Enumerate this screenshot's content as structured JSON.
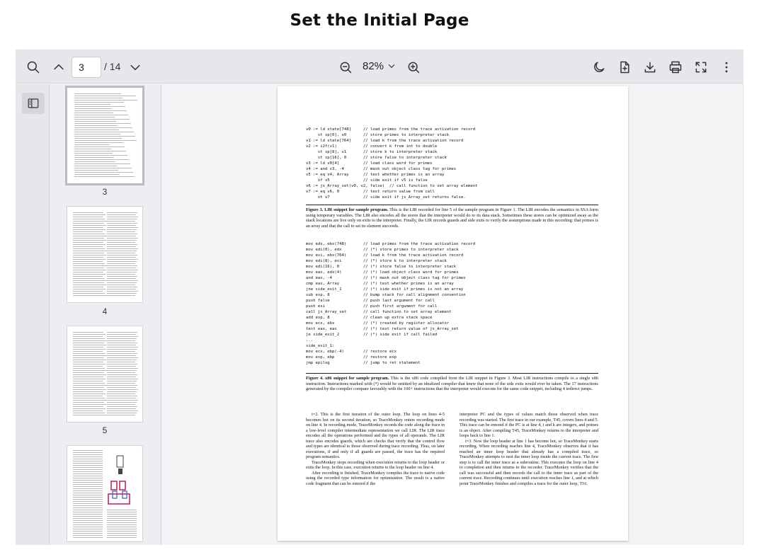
{
  "page_title": "Set the Initial Page",
  "toolbar": {
    "current_page": "3",
    "total_pages": "/ 14",
    "zoom": "82%"
  },
  "thumbnails": [
    {
      "label": "3",
      "active": true
    },
    {
      "label": "4",
      "active": false
    },
    {
      "label": "5",
      "active": false
    },
    {
      "label": "",
      "active": false
    }
  ],
  "document": {
    "code1": "v0 := ld state[748]     // load primes from the trace activation record\n     st sp[0], v0       // store primes to interpreter stack\nv1 := ld state[764]     // load k from the trace activation record\nv2 := i2f(v1)           // convert k from int to double\n     st sp[8], v1       // store k to interpreter stack\n     st sp[16], 0       // store false to interpreter stack\nv3 := ld v0[4]          // load class word for primes\nv4 := and v3, -4        // mask out object class tag for primes\nv5 := eq v4, Array      // test whether primes is an array\n     xf v5              // side exit if v5 is false\nv6 := js_Array_set(v0, v2, false)  // call function to set array element\nv7 := eq v6, 0          // test return value from call\n     xt v7              // side exit if js_Array_set returns false.",
    "caption1_bold": "Figure 3.  LIR snippet for sample program.",
    "caption1_text": " This is the LIR recorded for line 5 of the sample program in Figure 1. The LIR encodes the semantics in SSA form using temporary variables. The LIR also encodes all the stores that the interpreter would do to its data stack. Sometimes these stores can be optimized away as the stack locations are live only on exits to the interpreter. Finally, the LIR records guards and side exits to verify the assumptions made in this recording: that primes is an array and that the call to set its element succeeds.",
    "code2": "mov edx, ebx(748)       // load primes from the trace activation record\nmov edi(0), edx         // (*) store primes to interpreter stack\nmov esi, ebx(764)       // load k from the trace activation record\nmov edi(8), esi         // (*) store k to interpreter stack\nmov edi(16), 0          // (*) store false to interpreter stack\nmov eax, edx(4)         // (*) load object class word for primes\nand eax, -4             // (*) mask out object class tag for primes\ncmp eax, Array          // (*) test whether primes is an array\njne side_exit_1         // (*) side exit if primes is not an array\nsub esp, 8              // bump stack for call alignment convention\npush false              // push last argument for call\npush esi                // push first argument for call\ncall js_Array_set       // call function to set array element\nadd esp, 8              // clean up extra stack space\nmov ecx, ebx            // (*) created by register allocator\ntest eax, eax           // (*) test return value of js_Array_set\nje side_exit_2          // (*) side exit if call failed\n...\nside_exit_1:\nmov ecx, ebp(-4)        // restore ecx\nmov esp, ebp            // restore esp\njmp epilog              // jump to ret statement",
    "caption2_bold": "Figure 4.  x86 snippet for sample program.",
    "caption2_text": " This is the x86 code compiled from the LIR snippet in Figure 3. Most LIR instructions compile to a single x86 instruction. Instructions marked with (*) would be omitted by an idealized compiler that knew that none of the side exits would ever be taken. The 17 instructions generated by the compiler compare favorably with the 100+ instructions that the interpreter would execute for the same code snippet, including 4 indirect jumps.",
    "left_col": [
      "i=2. This is the first iteration of the outer loop. The loop on lines 4-5 becomes hot on its second iteration, so TraceMonkey enters recording mode on line 4. In recording mode, TraceMonkey records the code along the trace in a low-level compiler intermediate representation we call LIR. The LIR trace encodes all the operations performed and the types of all operands. The LIR trace also encodes guards, which are checks that verify that the control flow and types are identical to those observed during trace recording. Thus, on later executions, if and only if all guards are passed, the trace has the required program semantics.",
      "TraceMonkey stops recording when execution returns to the loop header or exits the loop. In this case, execution returns to the loop header on line 4.",
      "After recording is finished, TraceMonkey compiles the trace to native code using the recorded type information for optimization. The result is a native code fragment that can be entered if the"
    ],
    "right_col": [
      "interpreter PC and the types of values match those observed when trace recording was started. The first trace in our example, T45, covers lines 4 and 5. This trace can be entered if the PC is at line 4, i and k are integers, and primes is an object. After compiling T45, TraceMonkey returns to the interpreter and loops back to line 1.",
      "i=3. Now the loop header at line 1 has become hot, so TraceMonkey starts recording. When recording reaches line 4, TraceMonkey observes that it has reached an inner loop header that already has a compiled trace, so TraceMonkey attempts to nest the inner loop inside the current trace. The first step is to call the inner trace as a subroutine. This executes the loop on line 4 to completion and then returns to the recorder. TraceMonkey verifies that the call was successful and then records the call to the inner trace as part of the current trace. Recording continues until execution reaches line 1, and at which point TraceMonkey finishes and compiles a trace for the outer loop, T16."
    ]
  }
}
